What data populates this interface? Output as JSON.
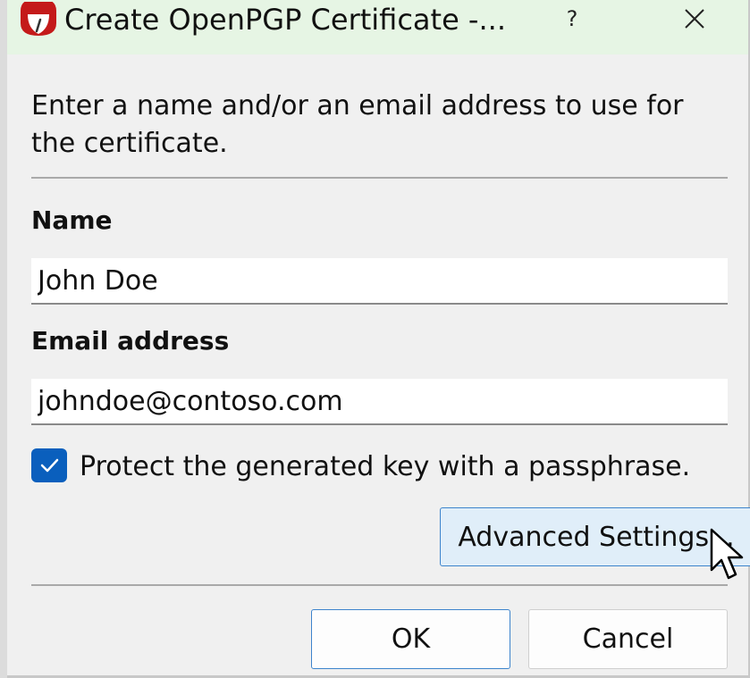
{
  "window": {
    "title": "Create OpenPGP Certificate -...",
    "help_label": "?",
    "close_label": "✕",
    "titlebar_color": "#e6f5e4"
  },
  "intro": {
    "text": "Enter a name and/or an email address to use for the certificate."
  },
  "form": {
    "name_label": "Name",
    "name_value": "John Doe",
    "email_label": "Email address",
    "email_value": "johndoe@contoso.com",
    "passphrase_checked": true,
    "passphrase_label": "Protect the generated key with a passphrase.",
    "checkbox_color": "#0a5fbd"
  },
  "buttons": {
    "advanced_label": "Advanced Settings...",
    "ok_label": "OK",
    "cancel_label": "Cancel",
    "accent_color": "#3d84cc"
  },
  "icons": {
    "app": "kleopatra-app-icon",
    "check": "checkmark-icon",
    "pointer": "mouse-pointer-icon"
  }
}
